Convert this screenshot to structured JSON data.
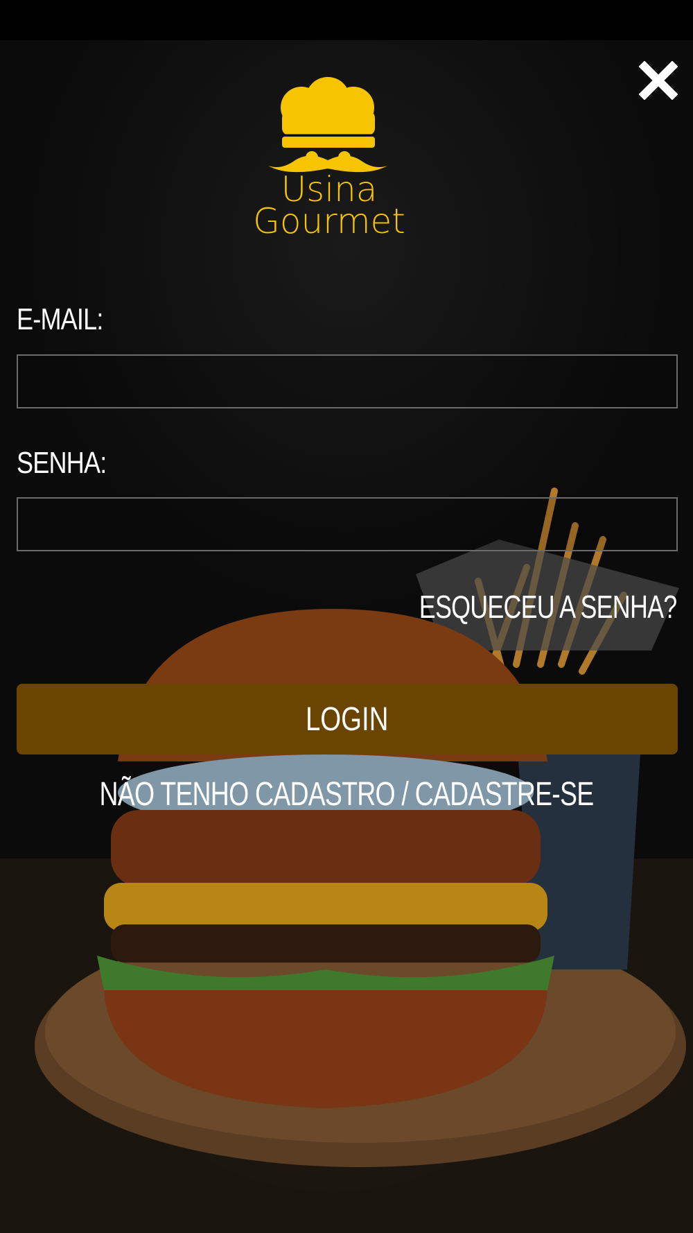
{
  "brand": {
    "name_line1": "Usina",
    "name_line2": "Gourmet",
    "color": "#F6C400"
  },
  "colors": {
    "background": "#0B0B0B",
    "login_button": "#6A4502",
    "input_border": "#6B6B6B",
    "text": "#FFFFFF"
  },
  "close": {
    "icon": "close-x-icon"
  },
  "form": {
    "email_label": "E-MAIL:",
    "email_value": "",
    "password_label": "SENHA:",
    "password_value": "",
    "forgot_label": "ESQUECEU A SENHA?",
    "login_label": "LOGIN",
    "register_label": "NÃO TENHO CADASTRO / CADASTRE-SE"
  }
}
